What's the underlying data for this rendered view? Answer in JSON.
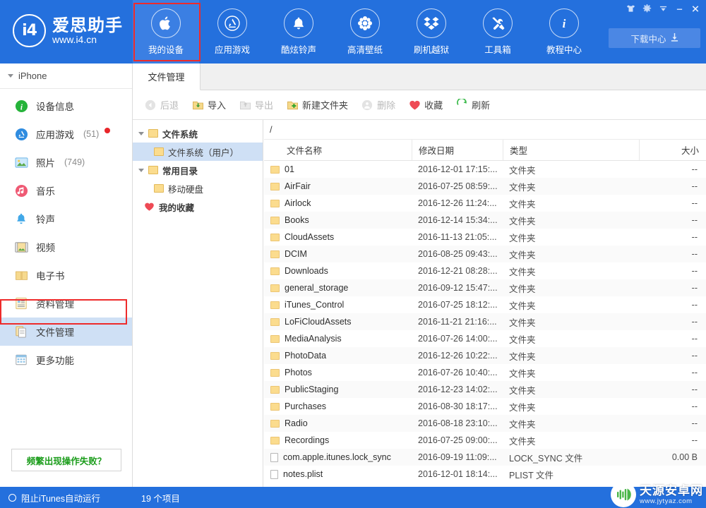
{
  "app": {
    "logo_mark": "i4",
    "logo_name": "爱思助手",
    "logo_url": "www.i4.cn"
  },
  "header": {
    "nav_tabs": [
      {
        "label": "我的设备",
        "icon": "apple-icon",
        "active": true
      },
      {
        "label": "应用游戏",
        "icon": "appstore-icon",
        "active": false
      },
      {
        "label": "酷炫铃声",
        "icon": "bell-icon",
        "active": false
      },
      {
        "label": "高清壁纸",
        "icon": "flower-icon",
        "active": false
      },
      {
        "label": "刷机越狱",
        "icon": "box-icon",
        "active": false
      },
      {
        "label": "工具箱",
        "icon": "tools-icon",
        "active": false
      },
      {
        "label": "教程中心",
        "icon": "info-icon",
        "active": false
      }
    ],
    "window_buttons": [
      {
        "name": "skin-icon",
        "glyph": "♛"
      },
      {
        "name": "settings-gear-icon",
        "glyph": "✿"
      },
      {
        "name": "menu-chevron-icon",
        "glyph": "▼"
      },
      {
        "name": "minimize-icon",
        "glyph": "–"
      },
      {
        "name": "close-icon",
        "glyph": "✕"
      }
    ],
    "download_center": {
      "label": "下载中心",
      "icon": "download-icon"
    }
  },
  "sidebar": {
    "device_name": "iPhone",
    "items": [
      {
        "label": "设备信息",
        "icon": "info-circle-icon",
        "count": "",
        "badge": false,
        "selected": false
      },
      {
        "label": "应用游戏",
        "icon": "appstore-circle-icon",
        "count": "(51)",
        "badge": true,
        "selected": false
      },
      {
        "label": "照片",
        "icon": "photo-icon",
        "count": "(749)",
        "badge": false,
        "selected": false
      },
      {
        "label": "音乐",
        "icon": "music-icon",
        "count": "",
        "badge": false,
        "selected": false
      },
      {
        "label": "铃声",
        "icon": "bell-icon",
        "count": "",
        "badge": false,
        "selected": false
      },
      {
        "label": "视频",
        "icon": "video-icon",
        "count": "",
        "badge": false,
        "selected": false
      },
      {
        "label": "电子书",
        "icon": "book-icon",
        "count": "",
        "badge": false,
        "selected": false
      },
      {
        "label": "资料管理",
        "icon": "data-icon",
        "count": "",
        "badge": false,
        "selected": false
      },
      {
        "label": "文件管理",
        "icon": "files-icon",
        "count": "",
        "badge": false,
        "selected": true
      },
      {
        "label": "更多功能",
        "icon": "grid-icon",
        "count": "",
        "badge": false,
        "selected": false
      }
    ],
    "help_button": "频繁出现操作失败？",
    "footer_toggle": "阻止iTunes自动运行"
  },
  "content": {
    "tab": "文件管理",
    "toolbar": [
      {
        "label": "后退",
        "icon": "back-icon",
        "disabled": true
      },
      {
        "label": "导入",
        "icon": "import-icon",
        "disabled": false
      },
      {
        "label": "导出",
        "icon": "export-icon",
        "disabled": true
      },
      {
        "label": "新建文件夹",
        "icon": "new-folder-icon",
        "disabled": false
      },
      {
        "label": "删除",
        "icon": "delete-icon",
        "disabled": true
      },
      {
        "label": "收藏",
        "icon": "heart-icon",
        "disabled": false
      },
      {
        "label": "刷新",
        "icon": "refresh-icon",
        "disabled": false
      }
    ],
    "tree": [
      {
        "label": "文件系统",
        "level": 0,
        "expandable": true,
        "bold": true,
        "icon": "folder-icon",
        "selected": false
      },
      {
        "label": "文件系统（用户）",
        "level": 1,
        "expandable": false,
        "bold": false,
        "icon": "folder-icon",
        "selected": true
      },
      {
        "label": "常用目录",
        "level": 0,
        "expandable": true,
        "bold": true,
        "icon": "folder-icon",
        "selected": false
      },
      {
        "label": "移动硬盘",
        "level": 1,
        "expandable": false,
        "bold": false,
        "icon": "folder-icon",
        "selected": false
      },
      {
        "label": "我的收藏",
        "level": 0,
        "expandable": false,
        "bold": true,
        "icon": "heart-icon",
        "selected": false
      }
    ],
    "path": "/",
    "columns": [
      "文件名称",
      "修改日期",
      "类型",
      "大小"
    ],
    "sort_indicator": "^",
    "files": [
      {
        "name": "01",
        "date": "2016-12-01 17:15:...",
        "type": "文件夹",
        "size": "--",
        "kind": "folder"
      },
      {
        "name": "AirFair",
        "date": "2016-07-25 08:59:...",
        "type": "文件夹",
        "size": "--",
        "kind": "folder"
      },
      {
        "name": "Airlock",
        "date": "2016-12-26 11:24:...",
        "type": "文件夹",
        "size": "--",
        "kind": "folder"
      },
      {
        "name": "Books",
        "date": "2016-12-14 15:34:...",
        "type": "文件夹",
        "size": "--",
        "kind": "folder"
      },
      {
        "name": "CloudAssets",
        "date": "2016-11-13 21:05:...",
        "type": "文件夹",
        "size": "--",
        "kind": "folder"
      },
      {
        "name": "DCIM",
        "date": "2016-08-25 09:43:...",
        "type": "文件夹",
        "size": "--",
        "kind": "folder"
      },
      {
        "name": "Downloads",
        "date": "2016-12-21 08:28:...",
        "type": "文件夹",
        "size": "--",
        "kind": "folder"
      },
      {
        "name": "general_storage",
        "date": "2016-09-12 15:47:...",
        "type": "文件夹",
        "size": "--",
        "kind": "folder"
      },
      {
        "name": "iTunes_Control",
        "date": "2016-07-25 18:12:...",
        "type": "文件夹",
        "size": "--",
        "kind": "folder"
      },
      {
        "name": "LoFiCloudAssets",
        "date": "2016-11-21 21:16:...",
        "type": "文件夹",
        "size": "--",
        "kind": "folder"
      },
      {
        "name": "MediaAnalysis",
        "date": "2016-07-26 14:00:...",
        "type": "文件夹",
        "size": "--",
        "kind": "folder"
      },
      {
        "name": "PhotoData",
        "date": "2016-12-26 10:22:...",
        "type": "文件夹",
        "size": "--",
        "kind": "folder"
      },
      {
        "name": "Photos",
        "date": "2016-07-26 10:40:...",
        "type": "文件夹",
        "size": "--",
        "kind": "folder"
      },
      {
        "name": "PublicStaging",
        "date": "2016-12-23 14:02:...",
        "type": "文件夹",
        "size": "--",
        "kind": "folder"
      },
      {
        "name": "Purchases",
        "date": "2016-08-30 18:17:...",
        "type": "文件夹",
        "size": "--",
        "kind": "folder"
      },
      {
        "name": "Radio",
        "date": "2016-08-18 23:10:...",
        "type": "文件夹",
        "size": "--",
        "kind": "folder"
      },
      {
        "name": "Recordings",
        "date": "2016-07-25 09:00:...",
        "type": "文件夹",
        "size": "--",
        "kind": "folder"
      },
      {
        "name": "com.apple.itunes.lock_sync",
        "date": "2016-09-19 11:09:...",
        "type": "LOCK_SYNC 文件",
        "size": "0.00 B",
        "kind": "file"
      },
      {
        "name": "notes.plist",
        "date": "2016-12-01 18:14:...",
        "type": "PLIST 文件",
        "size": "",
        "kind": "file"
      }
    ],
    "status": "19 个项目"
  },
  "watermark": {
    "title": "天源安卓网",
    "url": "www.jytyaz.com"
  },
  "colors": {
    "brand_blue": "#2470dd",
    "active_tab_blue": "#3b7fe3",
    "selection_blue": "#cfe0f5",
    "annotation_red": "#ee2b2b",
    "folder_yellow": "#fbdc8e",
    "help_green": "#1a9c1a"
  }
}
